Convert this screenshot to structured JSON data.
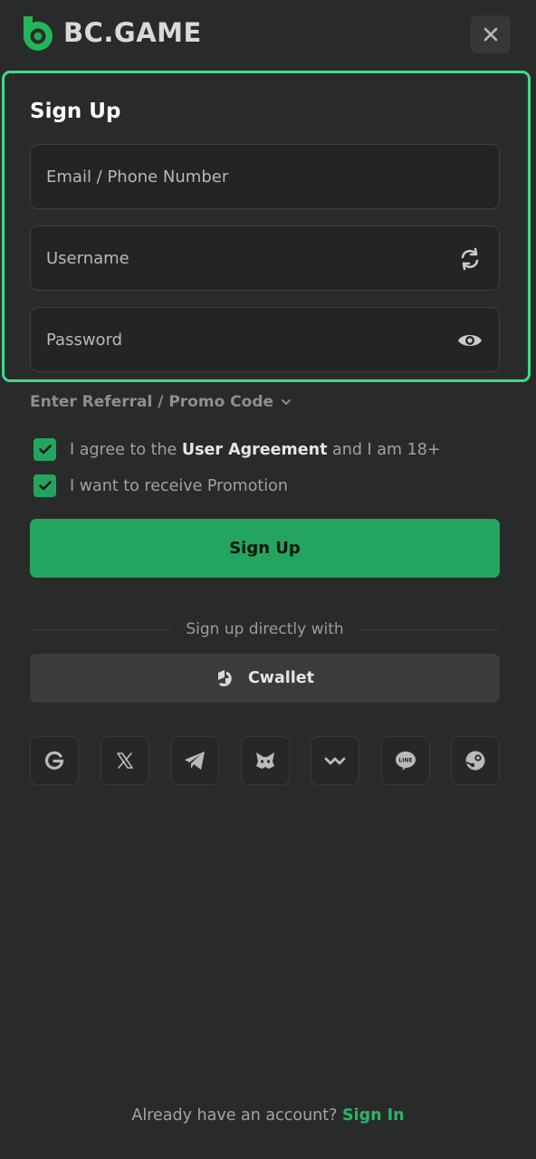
{
  "header": {
    "brand": "BC.GAME",
    "close_icon": "close-icon"
  },
  "form": {
    "title": "Sign Up",
    "email_placeholder": "Email / Phone Number",
    "username_placeholder": "Username",
    "password_placeholder": "Password",
    "username_icon": "refresh-icon",
    "password_icon": "eye-icon",
    "referral_label": "Enter Referral / Promo Code",
    "agreement": {
      "checked": true,
      "prefix": "I agree to the ",
      "link": "User Agreement",
      "suffix": " and I am 18+"
    },
    "promotion": {
      "checked": true,
      "label": "I want to receive Promotion"
    },
    "submit_label": "Sign Up"
  },
  "alt_signup": {
    "divider_text": "Sign up directly with",
    "cwallet_label": "Cwallet",
    "providers": [
      "google-icon",
      "x-icon",
      "telegram-icon",
      "metamask-icon",
      "walletconnect-icon",
      "line-icon",
      "steam-icon"
    ]
  },
  "footer": {
    "prompt": "Already have an account? ",
    "link": "Sign In"
  },
  "colors": {
    "background": "#292b2a",
    "accent": "#24a55f",
    "highlight_border": "#3ddc84",
    "link": "#27b865"
  }
}
